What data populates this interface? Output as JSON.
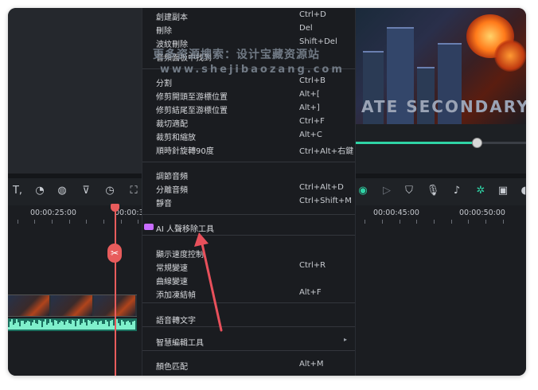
{
  "preview": {
    "overlay_text": "ATE SECONDARY",
    "progress": 0.71
  },
  "timeline": {
    "ruler_labels": [
      "00:00:25:00",
      "00:00:30",
      "00:00:45:00",
      "00:00:50:00"
    ]
  },
  "toolbar": {
    "left_icons": [
      "text-icon",
      "speed-icon",
      "color-icon",
      "mask-icon",
      "timer-icon",
      "crop-icon"
    ],
    "right_icons": [
      "ai-icon",
      "play-circle-icon",
      "shield-icon",
      "mic-icon",
      "music-note-icon",
      "sparkle-icon",
      "subtitle-icon"
    ]
  },
  "context_menu": {
    "items": [
      {
        "label": "創建副本",
        "shortcut": "Ctrl+D"
      },
      {
        "label": "刪除",
        "shortcut": "Del"
      },
      {
        "label": "波紋刪除",
        "shortcut": "Shift+Del"
      },
      {
        "label": "音頻面板中找到",
        "shortcut": ""
      },
      {
        "label": "分割",
        "shortcut": "Ctrl+B"
      },
      {
        "label": "修剪開頭至游標位置",
        "shortcut": "Alt+["
      },
      {
        "label": "修剪結尾至游標位置",
        "shortcut": "Alt+]"
      },
      {
        "label": "裁切適配",
        "shortcut": "Ctrl+F"
      },
      {
        "label": "裁剪和縮放",
        "shortcut": "Alt+C"
      },
      {
        "label": "順時針旋轉90度",
        "shortcut": "Ctrl+Alt+右鍵"
      },
      {
        "label": "調節音頻",
        "shortcut": ""
      },
      {
        "label": "分離音頻",
        "shortcut": "Ctrl+Alt+D"
      },
      {
        "label": "靜音",
        "shortcut": "Ctrl+Shift+M"
      },
      {
        "label": "AI 人聲移除工具",
        "shortcut": "",
        "badge": "AI"
      },
      {
        "label": "顯示速度控制",
        "shortcut": ""
      },
      {
        "label": "常規變速",
        "shortcut": "Ctrl+R"
      },
      {
        "label": "曲線變速",
        "shortcut": ""
      },
      {
        "label": "添加凍結幀",
        "shortcut": "Alt+F"
      },
      {
        "label": "語音轉文字",
        "shortcut": ""
      },
      {
        "label": "智慧編輯工具",
        "shortcut": "",
        "submenu": true
      },
      {
        "label": "顏色匹配",
        "shortcut": "Alt+M"
      }
    ]
  },
  "watermark": {
    "line1": "更多资源搜索：设计宝藏资源站",
    "line2": "www.shejibaozang.com"
  },
  "colors": {
    "accent": "#2fd3a5",
    "playhead": "#e85c5c",
    "annotation_arrow": "#e8505b",
    "ai_badge": "#c86cff"
  }
}
